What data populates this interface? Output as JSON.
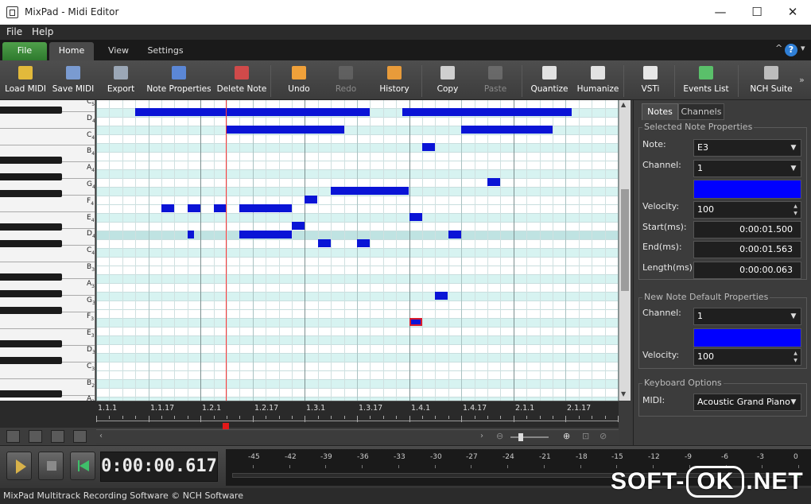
{
  "window": {
    "title": "MixPad - Midi Editor",
    "min_glyph": "—",
    "max_glyph": "☐",
    "close_glyph": "✕"
  },
  "menu": [
    "File",
    "Help"
  ],
  "tabs": [
    "File",
    "Home",
    "View",
    "Settings"
  ],
  "tab_right": {
    "up_glyph": "^",
    "help_glyph": "?",
    "dropdown_glyph": "▾"
  },
  "toolbar": [
    {
      "label": "Load MIDI",
      "icon": "folder-icon",
      "enabled": true
    },
    {
      "label": "Save MIDI",
      "icon": "save-midi-icon",
      "enabled": true
    },
    {
      "label": "Export",
      "icon": "export-icon",
      "enabled": true
    },
    {
      "label": "Note Properties",
      "icon": "note-properties-icon",
      "enabled": true
    },
    {
      "label": "Delete Note",
      "icon": "delete-note-icon",
      "enabled": true
    },
    {
      "label": "Undo",
      "icon": "undo-icon",
      "enabled": true
    },
    {
      "label": "Redo",
      "icon": "redo-icon",
      "enabled": false
    },
    {
      "label": "History",
      "icon": "history-icon",
      "enabled": true
    },
    {
      "label": "Copy",
      "icon": "copy-icon",
      "enabled": true
    },
    {
      "label": "Paste",
      "icon": "paste-icon",
      "enabled": false
    },
    {
      "label": "Quantize",
      "icon": "quantize-icon",
      "enabled": true
    },
    {
      "label": "Humanize",
      "icon": "humanize-icon",
      "enabled": true
    },
    {
      "label": "VSTi",
      "icon": "vsti-icon",
      "enabled": true
    },
    {
      "label": "Events List",
      "icon": "events-list-icon",
      "enabled": true
    },
    {
      "label": "NCH Suite",
      "icon": "nch-suite-icon",
      "enabled": true
    }
  ],
  "toolbar_more": "»",
  "piano_labels": [
    {
      "note": "C",
      "octave": "5"
    },
    {
      "note": "D",
      "octave": "4"
    },
    {
      "note": "C",
      "octave": "4"
    },
    {
      "note": "B",
      "octave": "4"
    },
    {
      "note": "A",
      "octave": "4"
    },
    {
      "note": "G",
      "octave": "4"
    },
    {
      "note": "F",
      "octave": "4"
    },
    {
      "note": "E",
      "octave": "4"
    },
    {
      "note": "D",
      "octave": "4"
    },
    {
      "note": "C",
      "octave": "4"
    },
    {
      "note": "B",
      "octave": "3"
    },
    {
      "note": "A",
      "octave": "3"
    },
    {
      "note": "G",
      "octave": "3"
    },
    {
      "note": "F",
      "octave": "3"
    },
    {
      "note": "E",
      "octave": "3"
    },
    {
      "note": "D",
      "octave": "3"
    },
    {
      "note": "C",
      "octave": "3"
    },
    {
      "note": "B",
      "octave": "2"
    },
    {
      "note": "A",
      "octave": "2"
    }
  ],
  "timeline": [
    "1.1.1",
    "1.1.17",
    "1.2.1",
    "1.2.17",
    "1.3.1",
    "1.3.17",
    "1.4.1",
    "1.4.17",
    "2.1.1",
    "2.1.17"
  ],
  "playhead_time": "0:00:00.617",
  "meter_labels": [
    "-45",
    "-42",
    "-39",
    "-36",
    "-33",
    "-30",
    "-27",
    "-24",
    "-21",
    "-18",
    "-15",
    "-12",
    "-9",
    "-6",
    "-3",
    "0"
  ],
  "panel": {
    "tabs": [
      "Notes",
      "Channels"
    ],
    "selected_title": "Selected Note Properties",
    "note_label": "Note:",
    "note_value": "E3",
    "channel_label": "Channel:",
    "channel_value": "1",
    "velocity_label": "Velocity:",
    "velocity_value": "100",
    "start_label": "Start(ms):",
    "start_value": "0:00:01.500",
    "end_label": "End(ms):",
    "end_value": "0:00:01.563",
    "length_label": "Length(ms):",
    "length_value": "0:00:00.063",
    "default_title": "New Note Default Properties",
    "default_channel_label": "Channel:",
    "default_channel_value": "1",
    "default_velocity_label": "Velocity:",
    "default_velocity_value": "100",
    "keyboard_title": "Keyboard Options",
    "midi_label": "MIDI:",
    "midi_value": "Acoustic Grand Piano",
    "note_color": "#0000ff"
  },
  "notes": [
    {
      "row": 1,
      "start": 3,
      "len": 18
    },
    {
      "row": 1,
      "start": 23.5,
      "len": 13
    },
    {
      "row": 3,
      "start": 10,
      "len": 9
    },
    {
      "row": 3,
      "start": 28,
      "len": 7
    },
    {
      "row": 5,
      "start": 25,
      "len": 1
    },
    {
      "row": 9,
      "start": 30,
      "len": 1
    },
    {
      "row": 10,
      "start": 18,
      "len": 6
    },
    {
      "row": 11,
      "start": 16,
      "len": 1
    },
    {
      "row": 12,
      "start": 5,
      "len": 1
    },
    {
      "row": 12,
      "start": 7,
      "len": 1
    },
    {
      "row": 12,
      "start": 9,
      "len": 1
    },
    {
      "row": 12,
      "start": 11,
      "len": 4
    },
    {
      "row": 13,
      "start": 24,
      "len": 1
    },
    {
      "row": 14,
      "start": 15,
      "len": 1
    },
    {
      "row": 15,
      "start": 7,
      "len": 0.5
    },
    {
      "row": 15,
      "start": 11,
      "len": 4
    },
    {
      "row": 15,
      "start": 27,
      "len": 1
    },
    {
      "row": 16,
      "start": 17,
      "len": 1
    },
    {
      "row": 16,
      "start": 20,
      "len": 1
    },
    {
      "row": 22,
      "start": 26,
      "len": 1
    },
    {
      "row": 25,
      "start": 24,
      "len": 1,
      "selected": true
    }
  ],
  "status": "MixPad Multitrack Recording Software © NCH Software",
  "watermark": {
    "left": "SOFT-",
    "ok": "OK",
    "right": ".NET"
  }
}
